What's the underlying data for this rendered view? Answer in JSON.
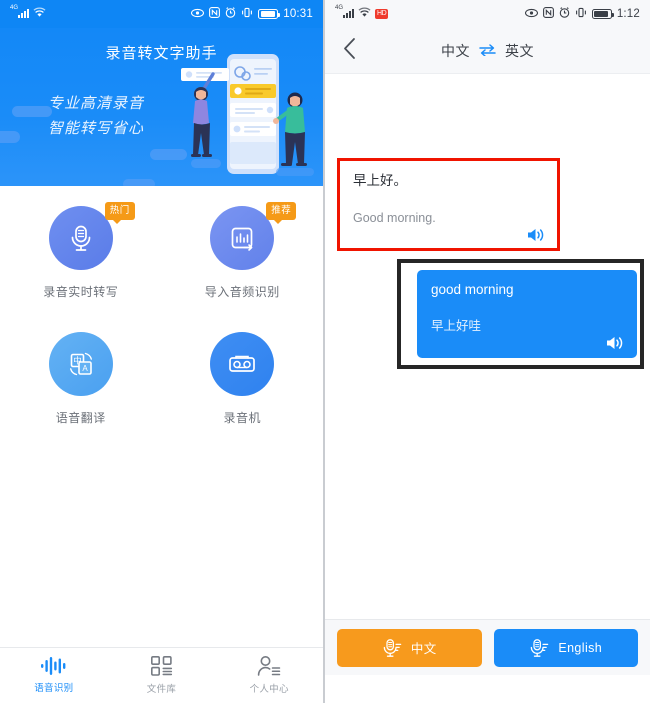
{
  "left": {
    "status_bar": {
      "network_label": "4G",
      "icons": [
        "signal-icon",
        "wifi-icon",
        "eye-icon",
        "nfc-icon",
        "alarm-icon",
        "vibrate-icon",
        "battery-icon"
      ],
      "time": "10:31"
    },
    "banner": {
      "title": "录音转文字助手",
      "subtitle_line1": "专业高清录音",
      "subtitle_line2": "智能转写省心"
    },
    "features": [
      {
        "label": "录音实时转写",
        "badge": "热门",
        "icon": "microphone-document-icon"
      },
      {
        "label": "导入音频识别",
        "badge": "推荐",
        "icon": "audio-import-icon"
      },
      {
        "label": "语音翻译",
        "badge": "",
        "icon": "translate-icon"
      },
      {
        "label": "录音机",
        "badge": "",
        "icon": "tape-recorder-icon"
      }
    ],
    "tabs": [
      {
        "label": "语音识别",
        "icon": "waveform-icon",
        "active": true
      },
      {
        "label": "文件库",
        "icon": "grid-list-icon",
        "active": false
      },
      {
        "label": "个人中心",
        "icon": "person-icon",
        "active": false
      }
    ]
  },
  "right": {
    "status_bar": {
      "network_label": "4G",
      "badge_text": "HD",
      "icons": [
        "signal-icon",
        "wifi-icon",
        "hd-badge-icon",
        "eye-icon",
        "nfc-icon",
        "alarm-icon",
        "vibrate-icon",
        "battery-icon"
      ],
      "time": "1:12"
    },
    "nav": {
      "back_icon": "chevron-left-icon",
      "source_lang": "中文",
      "swap_icon": "swap-arrows-icon",
      "target_lang": "英文"
    },
    "cards": [
      {
        "source": "早上好。",
        "target": "Good morning.",
        "speaker_icon": "speaker-icon",
        "highlight_color": "#f01400",
        "style": "white"
      },
      {
        "source": "good morning",
        "target": "早上好哇",
        "speaker_icon": "speaker-icon",
        "highlight_color": "#262626",
        "style": "blue"
      }
    ],
    "actions": [
      {
        "label": "中文",
        "icon": "microphone-lines-icon",
        "color": "#f79a1d"
      },
      {
        "label": "English",
        "icon": "microphone-lines-icon",
        "color": "#1a8cf8"
      }
    ]
  }
}
